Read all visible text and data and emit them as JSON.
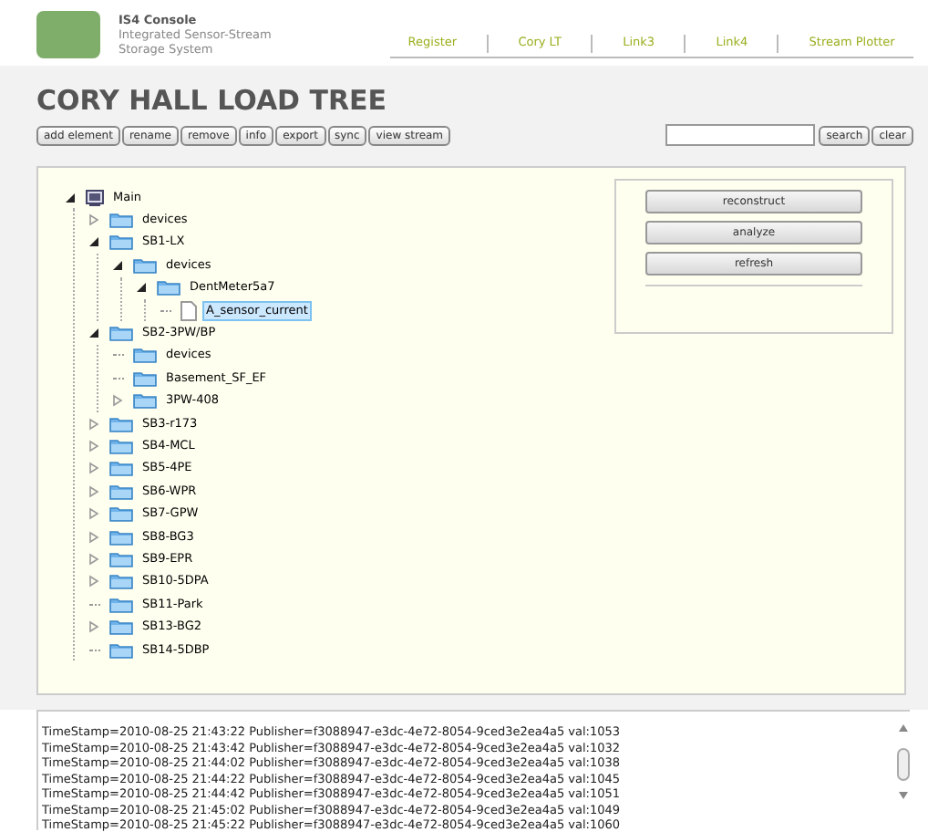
{
  "header": {
    "app_name": "IS4 Console",
    "subtitle_lines": [
      "Integrated Sensor-Stream",
      "Storage System"
    ],
    "nav_links": [
      "Register",
      "Cory LT",
      "Link3",
      "Link4",
      "Stream Plotter"
    ]
  },
  "page_title": "CORY HALL LOAD TREE",
  "toolbar": {
    "buttons": [
      "add element",
      "rename",
      "remove",
      "info",
      "export",
      "sync",
      "view stream"
    ],
    "search_buttons": [
      "search",
      "clear"
    ]
  },
  "tree": [
    {
      "label": "Main",
      "kind": "computer",
      "expanded": true,
      "selected": false,
      "children": [
        {
          "label": "devices",
          "kind": "folder",
          "expanded": false,
          "selected": false
        },
        {
          "label": "SB1-LX",
          "kind": "folder",
          "expanded": true,
          "selected": false,
          "children": [
            {
              "label": "devices",
              "kind": "folder",
              "expanded": true,
              "selected": false,
              "children": [
                {
                  "label": "DentMeter5a7",
                  "kind": "folder",
                  "expanded": true,
                  "selected": false,
                  "children": [
                    {
                      "label": "A_sensor_current",
                      "kind": "file",
                      "selected": true
                    }
                  ]
                }
              ]
            }
          ]
        },
        {
          "label": "SB2-3PW/BP",
          "kind": "folder",
          "expanded": true,
          "selected": false,
          "children": [
            {
              "label": "devices",
              "kind": "folder",
              "selected": false
            },
            {
              "label": "Basement_SF_EF",
              "kind": "folder",
              "selected": false
            },
            {
              "label": "3PW-408",
              "kind": "folder",
              "expanded": false,
              "selected": false
            }
          ]
        },
        {
          "label": "SB3-r173",
          "kind": "folder",
          "expanded": false,
          "selected": false
        },
        {
          "label": "SB4-MCL",
          "kind": "folder",
          "expanded": false,
          "selected": false
        },
        {
          "label": "SB5-4PE",
          "kind": "folder",
          "expanded": false,
          "selected": false
        },
        {
          "label": "SB6-WPR",
          "kind": "folder",
          "expanded": false,
          "selected": false
        },
        {
          "label": "SB7-GPW",
          "kind": "folder",
          "expanded": false,
          "selected": false
        },
        {
          "label": "SB8-BG3",
          "kind": "folder",
          "expanded": false,
          "selected": false
        },
        {
          "label": "SB9-EPR",
          "kind": "folder",
          "expanded": false,
          "selected": false
        },
        {
          "label": "SB10-5DPA",
          "kind": "folder",
          "expanded": false,
          "selected": false
        },
        {
          "label": "SB11-Park",
          "kind": "folder",
          "selected": false
        },
        {
          "label": "SB13-BG2",
          "kind": "folder",
          "expanded": false,
          "selected": false
        },
        {
          "label": "SB14-5DBP",
          "kind": "folder",
          "selected": false
        }
      ]
    }
  ],
  "action_buttons": [
    "reconstruct",
    "analyze",
    "refresh"
  ],
  "log_lines": [
    "TimeStamp=2010-08-25 21:43:22 Publisher=f3088947-e3dc-4e72-8054-9ced3e2ea4a5 val:1053",
    "TimeStamp=2010-08-25 21:43:42 Publisher=f3088947-e3dc-4e72-8054-9ced3e2ea4a5 val:1032",
    "TimeStamp=2010-08-25 21:44:02 Publisher=f3088947-e3dc-4e72-8054-9ced3e2ea4a5 val:1038",
    "TimeStamp=2010-08-25 21:44:22 Publisher=f3088947-e3dc-4e72-8054-9ced3e2ea4a5 val:1045",
    "TimeStamp=2010-08-25 21:44:42 Publisher=f3088947-e3dc-4e72-8054-9ced3e2ea4a5 val:1051",
    "TimeStamp=2010-08-25 21:45:02 Publisher=f3088947-e3dc-4e72-8054-9ced3e2ea4a5 val:1049",
    "TimeStamp=2010-08-25 21:45:22 Publisher=f3088947-e3dc-4e72-8054-9ced3e2ea4a5 val:1060"
  ]
}
